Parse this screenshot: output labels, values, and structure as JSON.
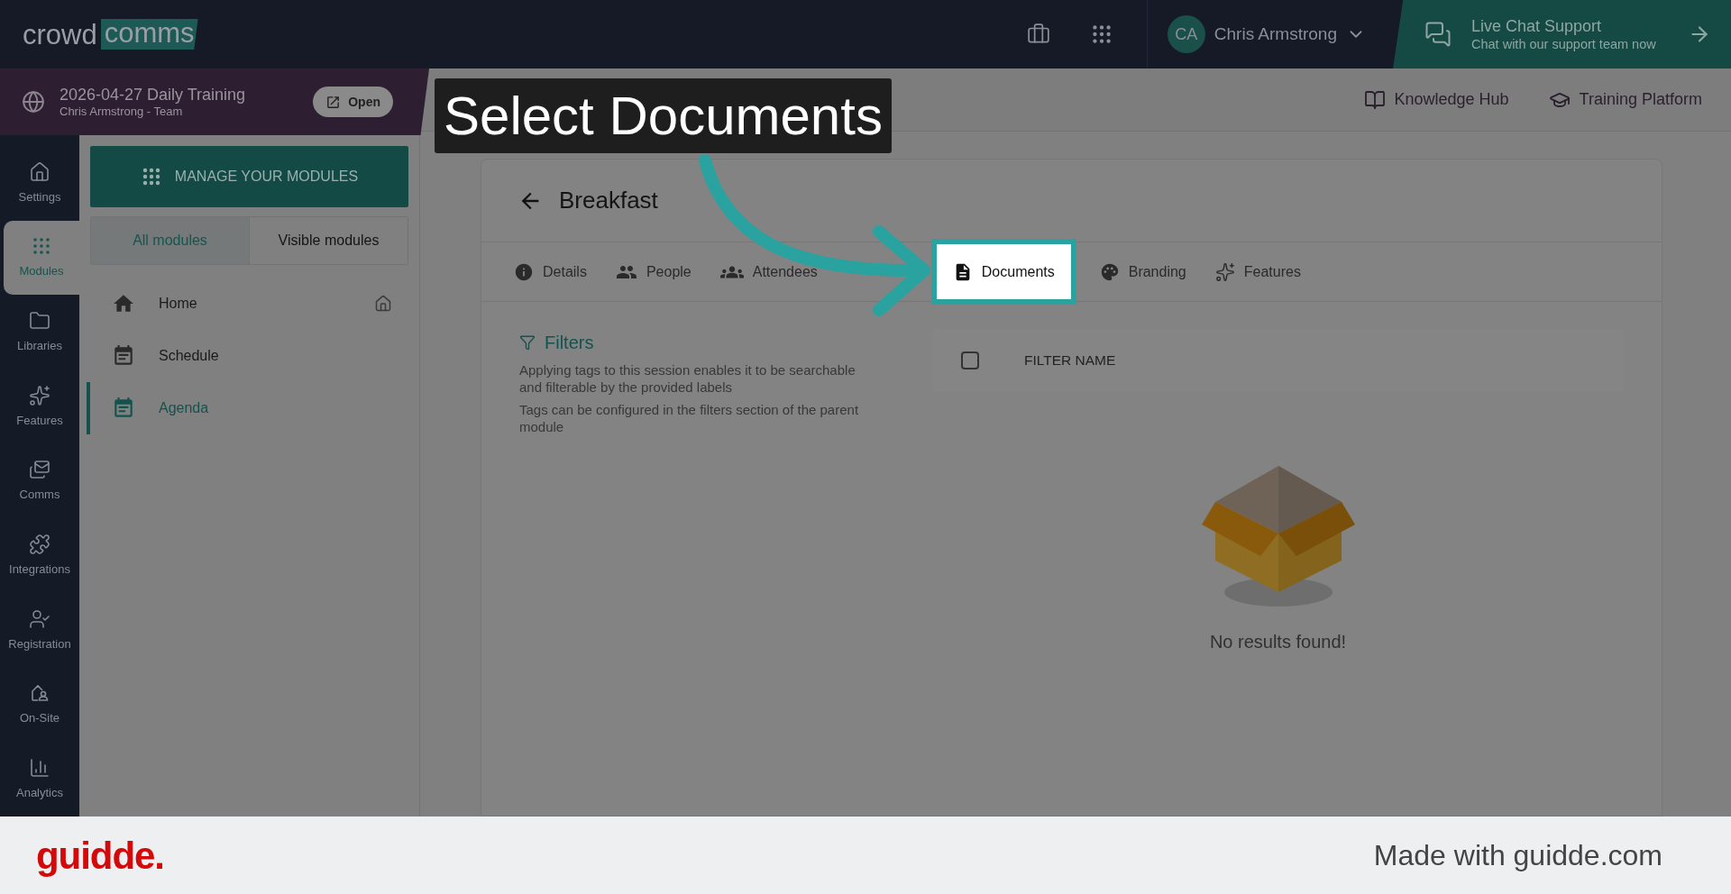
{
  "brand": {
    "logo_left": "crowd",
    "logo_right": "comms"
  },
  "topbar": {
    "user": {
      "initials": "CA",
      "name": "Chris Armstrong"
    },
    "support": {
      "title": "Live Chat Support",
      "subtitle": "Chat with our support team now"
    }
  },
  "event": {
    "title": "2026-04-27 Daily Training",
    "subtitle": "Chris Armstrong - Team",
    "open_button": "Open"
  },
  "header_links": [
    {
      "label": "Knowledge Hub"
    },
    {
      "label": "Training Platform"
    }
  ],
  "rail": [
    {
      "label": "Settings",
      "selected": false
    },
    {
      "label": "Modules",
      "selected": true
    },
    {
      "label": "Libraries",
      "selected": false
    },
    {
      "label": "Features",
      "selected": false
    },
    {
      "label": "Comms",
      "selected": false
    },
    {
      "label": "Integrations",
      "selected": false
    },
    {
      "label": "Registration",
      "selected": false
    },
    {
      "label": "On-Site",
      "selected": false
    },
    {
      "label": "Analytics",
      "selected": false
    }
  ],
  "modules_panel": {
    "manage_button": "MANAGE YOUR MODULES",
    "filters": [
      {
        "label": "All modules",
        "selected": true
      },
      {
        "label": "Visible modules",
        "selected": false
      }
    ],
    "items": [
      {
        "label": "Home",
        "selected": false,
        "pinned": true
      },
      {
        "label": "Schedule",
        "selected": false,
        "pinned": false
      },
      {
        "label": "Agenda",
        "selected": true,
        "pinned": false
      }
    ]
  },
  "page": {
    "title": "Breakfast",
    "tabs": [
      {
        "label": "Details",
        "selected": false
      },
      {
        "label": "People",
        "selected": false
      },
      {
        "label": "Attendees",
        "selected": false
      },
      {
        "label": "Documents",
        "selected": true
      },
      {
        "label": "Branding",
        "selected": false
      },
      {
        "label": "Features",
        "selected": false
      }
    ]
  },
  "filters_section": {
    "title": "Filters",
    "paragraphs": [
      "Applying tags to this session enables it to be searchable and filterable by the provided labels",
      "Tags can be configured in the filters section of the parent module"
    ]
  },
  "table": {
    "columns": [
      "FILTER NAME"
    ],
    "select_all_checked": false
  },
  "empty_state": "No results found!",
  "callout": {
    "text": "Select Documents"
  },
  "footer": {
    "logo": "guidde.",
    "credit": "Made with guidde.com"
  }
}
